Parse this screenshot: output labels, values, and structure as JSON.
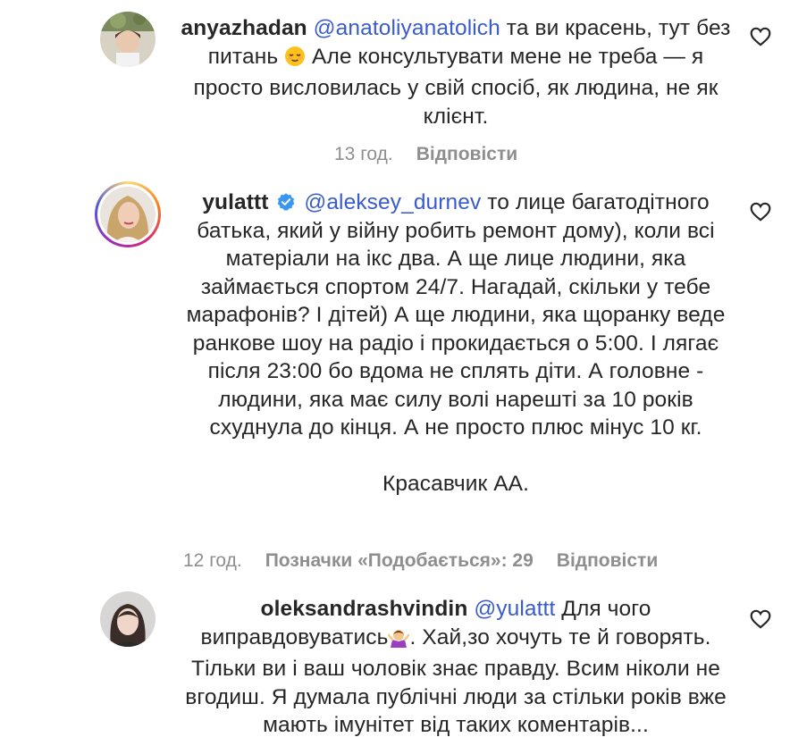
{
  "comments": [
    {
      "username": "anyazhadan",
      "mention": "@anatoliyanatolich",
      "text_part1": "та ви красень, тут без питань",
      "text_part2": "Але консультувати мене не треба — я просто висловилась у свій спосіб, як людина, не як клієнт.",
      "time": "13 год.",
      "reply_label": "Відповісти"
    },
    {
      "username": "yulattt",
      "verified": true,
      "mention": "@aleksey_durnev",
      "text": "то лице багатодітного батька, який у війну робить ремонт дому), коли всі матеріали на ікс два. А ще лице людини, яка займається спортом 24/7. Нагадай, скільки у тебе марафонів? І дітей) А ще людини, яка щоранку веде ранкове шоу на радіо і прокидається о 5:00. І лягає після 23:00 бо вдома не сплять діти. А головне - людини, яка має силу волі нарешті за 10 років схуднула до кінця. А не просто плюс мінус 10 кг.",
      "text_extra": "Красавчик АА.",
      "time": "12 год.",
      "likes_label": "Позначки «Подобається»: 29",
      "reply_label": "Відповісти"
    },
    {
      "username": "oleksandrashvindin",
      "mention": "@yulattt",
      "text_part1": "Для чого виправдовуватись",
      "text_part2": ". Хай,зо хочуть те й говорять. Тільки ви і ваш чоловік знає правду. Всим ніколи не вгодиш. Я думала публічні люди за стільки років вже мають імунітет від таких коментарів..."
    }
  ],
  "colors": {
    "text": "#262626",
    "mention": "#3a5bcc",
    "meta": "#8e8e8e",
    "verified": "#3897f0"
  },
  "icons": [
    "heart-icon",
    "verified-badge-icon",
    "relieved-face-emoji",
    "woman-shrugging-emoji"
  ]
}
